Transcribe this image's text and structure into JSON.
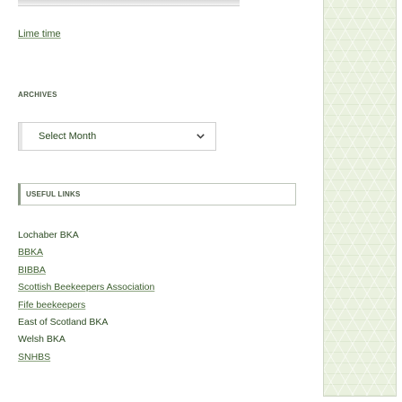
{
  "widgets": {
    "recent_link": "Lime time",
    "archives": {
      "title": "ARCHIVES",
      "select": {
        "selected": "Select Month"
      }
    },
    "useful_links": {
      "title": "USEFUL LINKS",
      "items": [
        {
          "label": "Lochaber BKA",
          "linked": false
        },
        {
          "label": "BBKA",
          "linked": true
        },
        {
          "label": "BIBBA",
          "linked": true
        },
        {
          "label": "Scottish Beekeepers Association",
          "linked": true
        },
        {
          "label": "Fife beekeepers",
          "linked": true
        },
        {
          "label": "East of Scotland BKA",
          "linked": false
        },
        {
          "label": "Welsh BKA",
          "linked": false
        },
        {
          "label": "SNHBS",
          "linked": true
        }
      ]
    }
  },
  "colors": {
    "text": "#2b4a22",
    "link": "#3b5d2d",
    "panel_bg": "#eaf1df"
  },
  "icons": {
    "select_arrow": "chevron-down-icon"
  }
}
